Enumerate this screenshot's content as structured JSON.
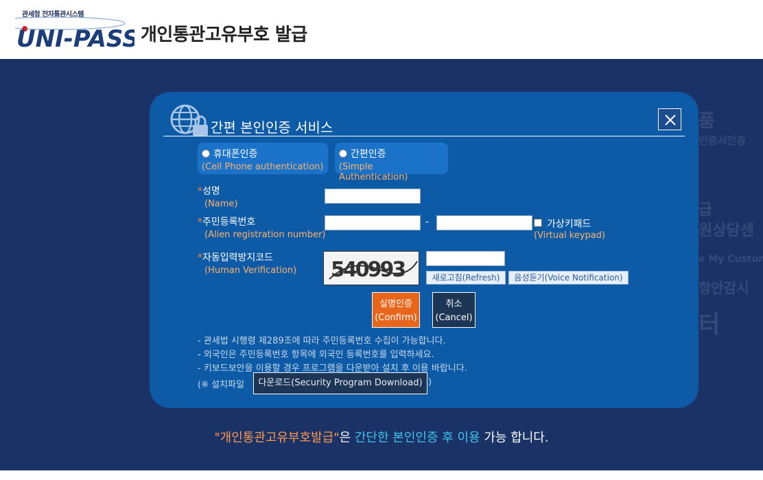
{
  "header": {
    "logo_sub": "관세청 전자통관시스템",
    "logo_text": "UNI-PASS",
    "title": "개인통관고유부호 발급"
  },
  "background": {
    "ghost_text": [
      "품",
      "인증서인증",
      "급",
      "원상담센",
      "e My Custom",
      "항안감시",
      "터"
    ]
  },
  "modal": {
    "title": "간편 본인인증 서비스",
    "close_label": "X",
    "tabs": [
      {
        "ko": "휴대폰인증",
        "en": "(Cell Phone authentication)"
      },
      {
        "ko": "간편인증",
        "en": "(Simple Authentication)"
      }
    ],
    "fields": {
      "name": {
        "label": "성명",
        "label_en": "(Name)",
        "value": ""
      },
      "reg": {
        "label": "주민등록번호",
        "label_en": "(Alien registration number)",
        "value1": "",
        "value2": "",
        "dash": "-"
      },
      "virtual_keypad": {
        "label": "가상키패드",
        "label_en": "(Virtual keypad)",
        "checked": false
      },
      "captcha": {
        "label": "자동입력방지코드",
        "label_en": "(Human Verification)",
        "code": "540993",
        "value": ""
      }
    },
    "star": "*",
    "buttons": {
      "refresh": "새로고침(Refresh)",
      "voice": "음성듣기(Voice Notification)",
      "confirm_ko": "실명인증",
      "confirm_en": "(Confirm)",
      "cancel_ko": "취소",
      "cancel_en": "(Cancel)",
      "download": "다운로드(Security Program Download)"
    },
    "notes": [
      "- 관세법 시행령 제289조에 따라 주민등록번호 수집이 가능합니다.",
      "- 외국인은 주민등록번호 항목에 외국인 등록번호를 입력하세요.",
      "- 키보드보안을 이용할 경우 프로그램을 다운받아 설치 후 이용 바랍니다."
    ],
    "install_prefix": "(※ 설치파일",
    "install_suffix": ")"
  },
  "slogan": {
    "part1": "\"개인통관고유부호발급\"",
    "part2": "은 ",
    "part3": "간단한 본인인증 후 이용",
    "part4": " 가능 합니다."
  },
  "colors": {
    "band": "#1a3266",
    "modal": "#0d5aa6",
    "accent_orange": "#e8661b",
    "label_orange": "#ffb36b",
    "slogan_cyan": "#3ec5ec"
  }
}
